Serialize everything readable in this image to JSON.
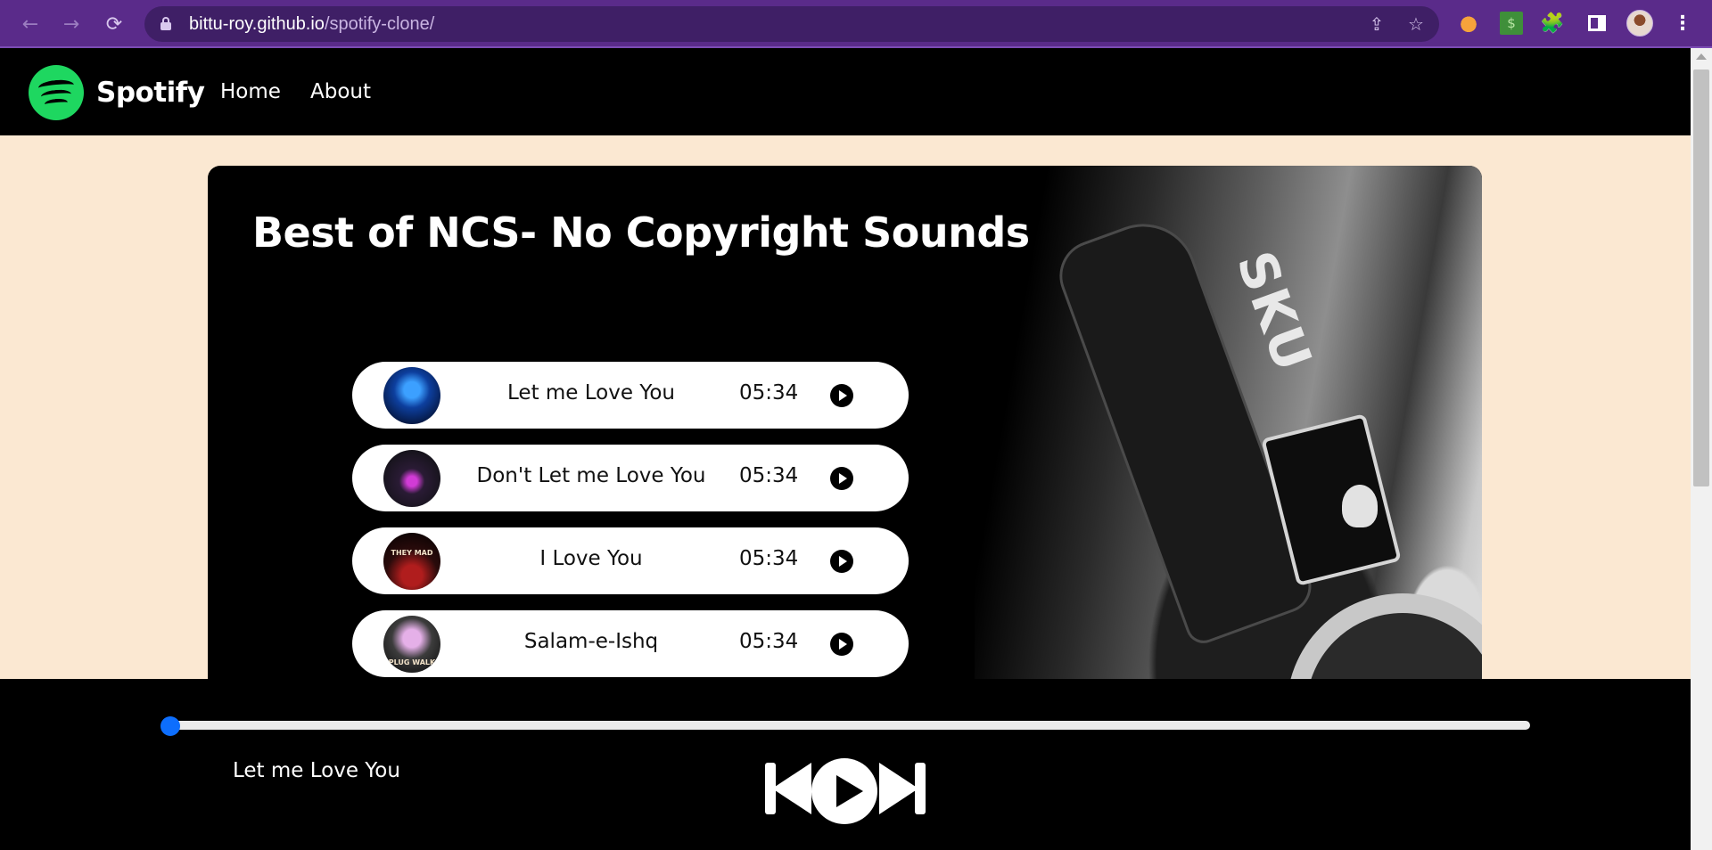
{
  "browser": {
    "url_domain": "bittu-roy.github.io",
    "url_path": "/spotify-clone/",
    "back_icon": "←",
    "forward_icon": "→",
    "reload_icon": "⟳",
    "share_icon": "⇪",
    "star_icon": "☆",
    "puzzle_icon": "🧩",
    "dollar_icon": "$",
    "menu_icon": "⋮"
  },
  "site": {
    "brand": "Spotify",
    "nav": [
      "Home",
      "About"
    ]
  },
  "album": {
    "title": "Best of NCS- No Copyright Sounds",
    "headphone_brand": "SKU"
  },
  "songs": [
    {
      "name": "Let me Love You",
      "duration": "05:34",
      "thumb_text": ""
    },
    {
      "name": "Don't Let me Love You",
      "duration": "05:34",
      "thumb_text": ""
    },
    {
      "name": "I Love You",
      "duration": "05:34",
      "thumb_text": "THEY MAD"
    },
    {
      "name": "Salam-e-Ishq",
      "duration": "05:34",
      "thumb_text": "PLUG WALK"
    }
  ],
  "player": {
    "now_playing": "Let me Love You",
    "progress_percent": 0,
    "accent_color": "#0d6efd"
  },
  "colors": {
    "browser_frame": "#5a2b8a",
    "spotify_green": "#1ed760",
    "page_bg": "#fbe8d2"
  }
}
